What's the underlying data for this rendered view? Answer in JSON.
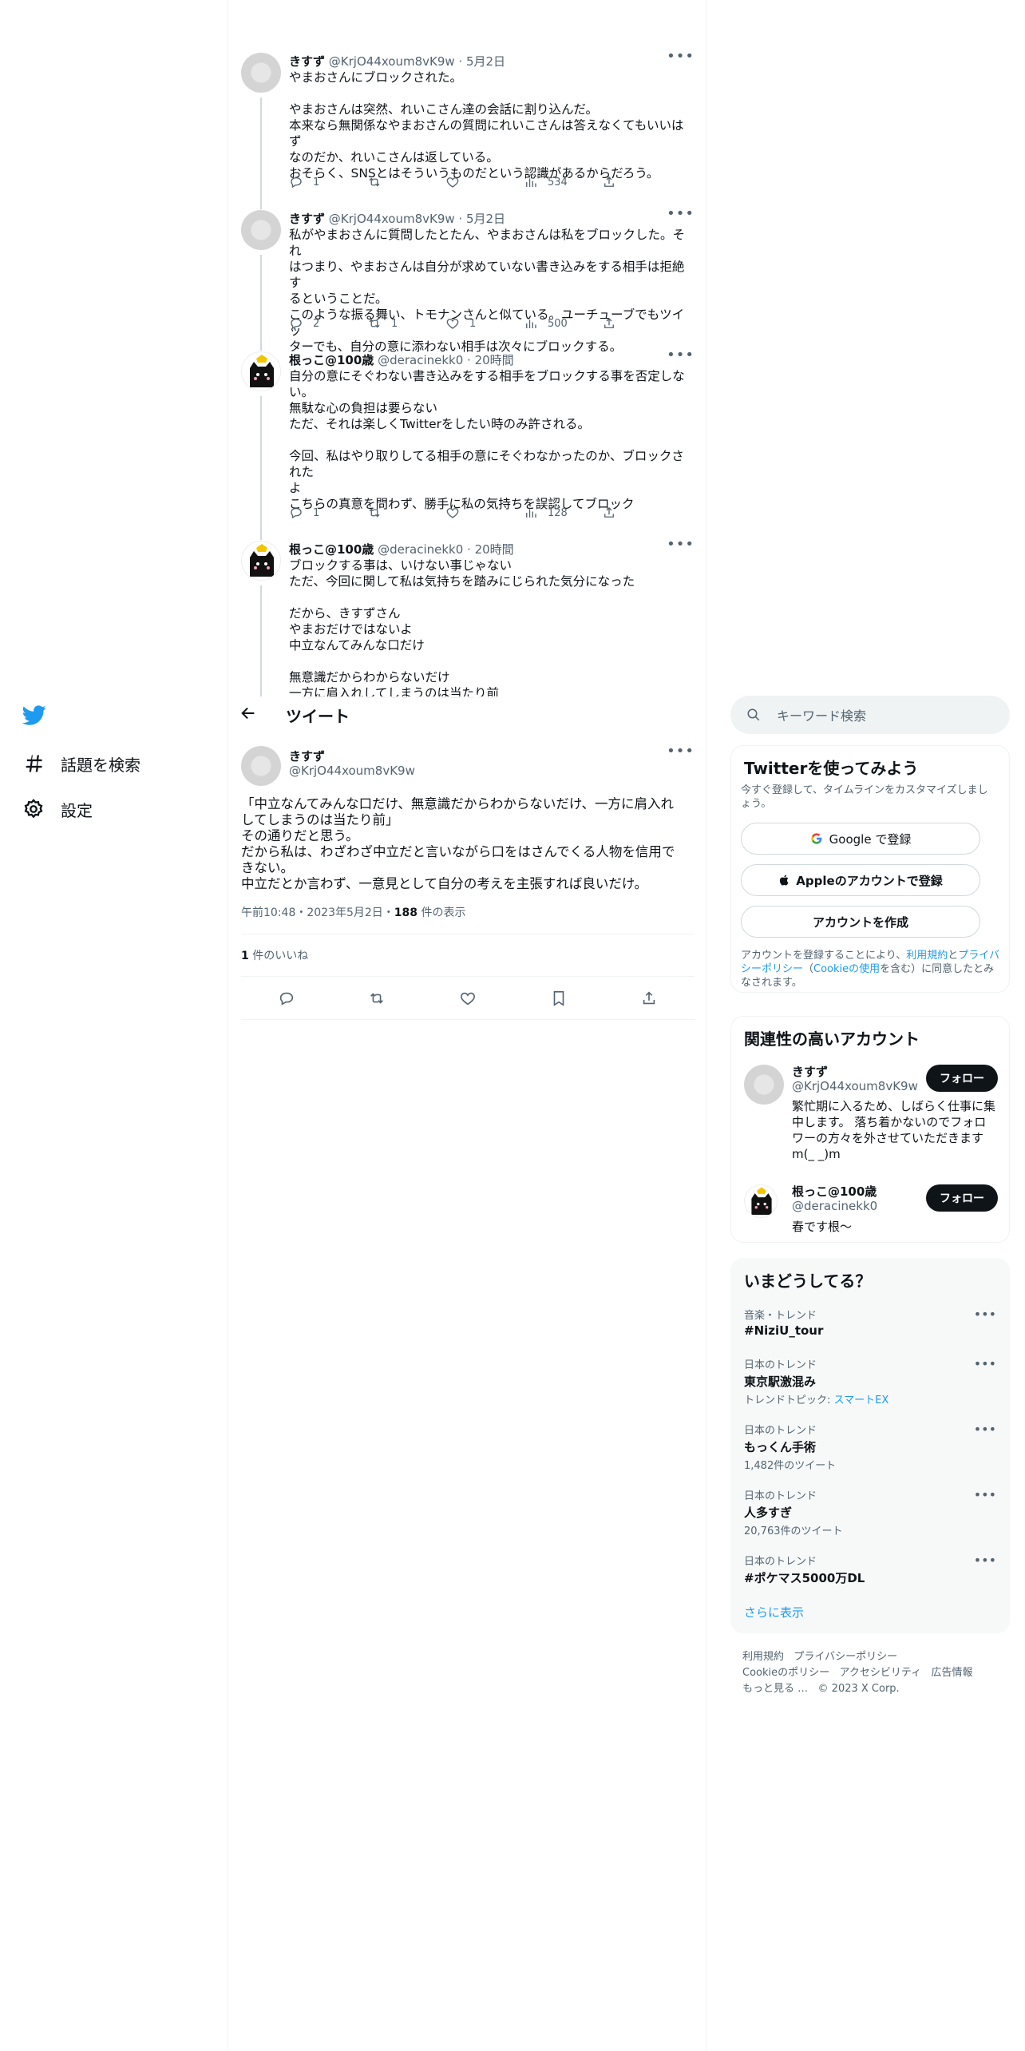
{
  "nav": {
    "explore_label": "話題を検索",
    "settings_label": "設定"
  },
  "thread": [
    {
      "name": "きすず",
      "handle": "@KrjO44xoum8vK9w",
      "time": "5月2日",
      "lines": [
        "やまおさんにブロックされた。",
        "",
        "やまおさんは突然、れいこさん達の会話に割り込んだ。",
        "本来なら無関係なやまおさんの質問にれいこさんは答えなくてもいいはず",
        "なのだか、れいこさんは返している。",
        "おそらく、SNSとはそういうものだという認識があるからだろう。"
      ],
      "replies": "1",
      "retweets": "",
      "likes": "",
      "views": "534"
    },
    {
      "name": "きすず",
      "handle": "@KrjO44xoum8vK9w",
      "time": "5月2日",
      "lines": [
        "私がやまおさんに質問したとたん、やまおさんは私をブロックした。それ",
        "はつまり、やまおさんは自分が求めていない書き込みをする相手は拒絶す",
        "るということだ。",
        "このような振る舞い、トモナンさんと似ている。ユーチューブでもツイッ",
        "ターでも、自分の意に添わない相手は次々にブロックする。"
      ],
      "replies": "2",
      "retweets": "1",
      "likes": "1",
      "views": "500"
    },
    {
      "name": "根っこ@100歳",
      "handle": "@deracinekk0",
      "time": "20時間",
      "lines": [
        "自分の意にそぐわない書き込みをする相手をブロックする事を否定しな",
        "い。",
        "無駄な心の負担は要らない",
        "ただ、それは楽しくTwitterをしたい時のみ許される。",
        "",
        "今回、私はやり取りしてる相手の意にそぐわなかったのか、ブロックされた",
        "よ",
        "こちらの真意を問わず、勝手に私の気持ちを誤認してブロック"
      ],
      "replies": "1",
      "retweets": "",
      "likes": "",
      "views": "128"
    },
    {
      "name": "根っこ@100歳",
      "handle": "@deracinekk0",
      "time": "20時間",
      "lines": [
        "ブロックする事は、いけない事じゃない",
        "ただ、今回に関して私は気持ちを踏みにじられた気分になった",
        "",
        "だから、きすずさん",
        "やまおだけではないよ",
        "中立なんてみんな口だけ",
        "",
        "無意識だからわからないだけ",
        "一方に肩入れしてしまうのは当たり前"
      ]
    }
  ],
  "header": {
    "title": "ツイート"
  },
  "main_tweet": {
    "name": "きすず",
    "handle": "@KrjO44xoum8vK9w",
    "lines": [
      "「中立なんてみんな口だけ、無意識だからわからないだけ、一方に肩入れ",
      "してしまうのは当たり前」",
      "その通りだと思う。",
      "だから私は、わざわざ中立だと言いながら口をはさんでくる人物を信用で",
      "きない。",
      "中立だとか言わず、一意見として自分の考えを主張すれば良いだけ。"
    ],
    "timestamp": "午前10:48・2023年5月2日・",
    "views_count": "188",
    "views_label": " 件の表示",
    "likes_count": "1",
    "likes_label": " 件のいいね"
  },
  "search": {
    "placeholder": "キーワード検索"
  },
  "signup": {
    "title": "Twitterを使ってみよう",
    "subtitle": "今すぐ登録して、タイムラインをカスタマイズしましょう。",
    "google": "Google で登録",
    "apple": "Appleのアカウントで登録",
    "create": "アカウントを作成",
    "legal_1": "アカウントを登録することにより、",
    "legal_terms": "利用規約",
    "legal_2": "と",
    "legal_privacy": "プライバシーポリシー",
    "legal_3": "（",
    "legal_cookie": "Cookieの使用",
    "legal_4": "を含む）に同意したとみなされます。"
  },
  "related": {
    "title": "関連性の高いアカウント",
    "accounts": [
      {
        "name": "きすず",
        "handle": "@KrjO44xoum8vK9w",
        "bio": "繁忙期に入るため、しばらく仕事に集中します。 落ち着かないのでフォロワーの方々を外させていただきますm(_ _)m",
        "button": "フォロー"
      },
      {
        "name": "根っこ@100歳",
        "handle": "@deracinekk0",
        "bio": "春です根～",
        "button": "フォロー"
      }
    ]
  },
  "trends": {
    "title": "いまどうしてる？",
    "items": [
      {
        "meta": "音楽・トレンド",
        "name": "#NiziU_tour",
        "sub": ""
      },
      {
        "meta": "日本のトレンド",
        "name": "東京駅激混み",
        "sub": "トレンドトピック: ",
        "sub_link": "スマートEX"
      },
      {
        "meta": "日本のトレンド",
        "name": "もっくん手術",
        "sub": "1,482件のツイート"
      },
      {
        "meta": "日本のトレンド",
        "name": "人多すぎ",
        "sub": "20,763件のツイート"
      },
      {
        "meta": "日本のトレンド",
        "name": "#ポケマス5000万DL",
        "sub": ""
      }
    ],
    "show_more": "さらに表示"
  },
  "footer": {
    "line1": [
      "利用規約",
      "プライバシーポリシー"
    ],
    "line2": [
      "Cookieのポリシー",
      "アクセシビリティ",
      "広告情報"
    ],
    "line3": [
      "もっと見る …",
      "© 2023 X Corp."
    ]
  },
  "colors": {
    "accent": "#1d9bf0",
    "text": "#0f1419",
    "muted": "#536471"
  }
}
